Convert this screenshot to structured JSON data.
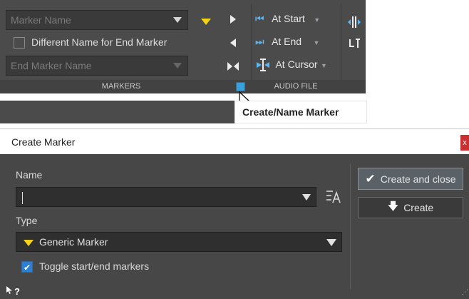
{
  "ribbon": {
    "marker_name_placeholder": "Marker Name",
    "different_name_label": "Different Name for End Marker",
    "end_marker_name_placeholder": "End Marker Name",
    "markers_group_label": "MARKERS",
    "audio_file_group_label": "AUDIO FILE",
    "at_start_label": "At Start",
    "at_end_label": "At End",
    "at_cursor_label": "At Cursor",
    "dropdown_glyph": "▼",
    "icons": [
      "yellow-marker-triangle-icon",
      "play-right-icon",
      "play-left-icon",
      "bow-tie-icon",
      "go-start-icon",
      "go-end-icon",
      "cursor-marker-icon",
      "split-icon",
      "trim-icon",
      "dialog-launcher-icon",
      "mouse-pointer-icon"
    ]
  },
  "tooltip": {
    "text": "Create/Name Marker"
  },
  "dialog": {
    "title": "Create Marker",
    "close_label": "x",
    "name_label": "Name",
    "name_value": "",
    "type_label": "Type",
    "type_value": "Generic Marker",
    "toggle_label": "Toggle start/end markers",
    "toggle_checked": true,
    "create_and_close_label": "Create and close",
    "create_label": "Create",
    "help_glyph": "?",
    "colors": {
      "accent": "#2f7fd1",
      "marker_yellow": "#f2d21b",
      "close_red": "#c8312f"
    }
  }
}
